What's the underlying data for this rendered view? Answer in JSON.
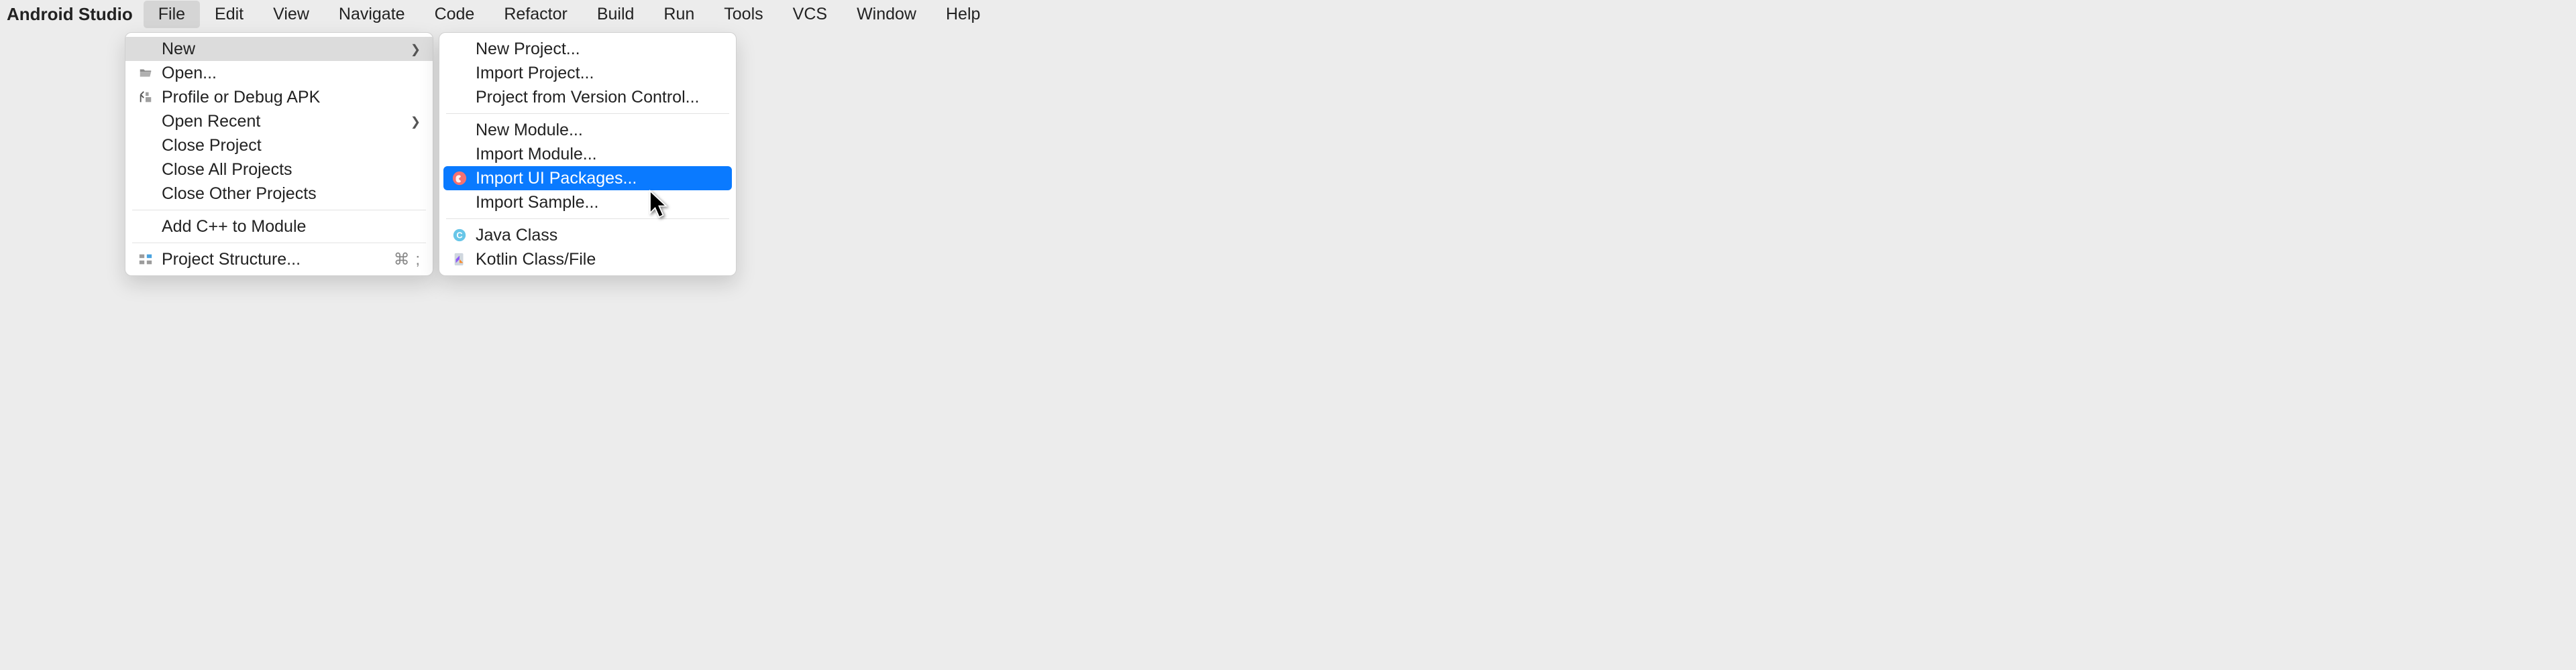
{
  "app_name": "Android Studio",
  "menubar": {
    "items": [
      "File",
      "Edit",
      "View",
      "Navigate",
      "Code",
      "Refactor",
      "Build",
      "Run",
      "Tools",
      "VCS",
      "Window",
      "Help"
    ],
    "active": "File"
  },
  "file_menu": {
    "new": "New",
    "open": "Open...",
    "profile_or_debug_apk": "Profile or Debug APK",
    "open_recent": "Open Recent",
    "close_project": "Close Project",
    "close_all_projects": "Close All Projects",
    "close_other_projects": "Close Other Projects",
    "add_cpp_to_module": "Add C++ to Module",
    "project_structure": "Project Structure...",
    "project_structure_shortcut": "⌘ ;"
  },
  "new_submenu": {
    "new_project": "New Project...",
    "import_project": "Import Project...",
    "project_from_vcs": "Project from Version Control...",
    "new_module": "New Module...",
    "import_module": "Import Module...",
    "import_ui_packages": "Import UI Packages...",
    "import_sample": "Import Sample...",
    "java_class": "Java Class",
    "kotlin_class_file": "Kotlin Class/File"
  },
  "chevron_glyph": "❯",
  "selected_item": "import_ui_packages"
}
